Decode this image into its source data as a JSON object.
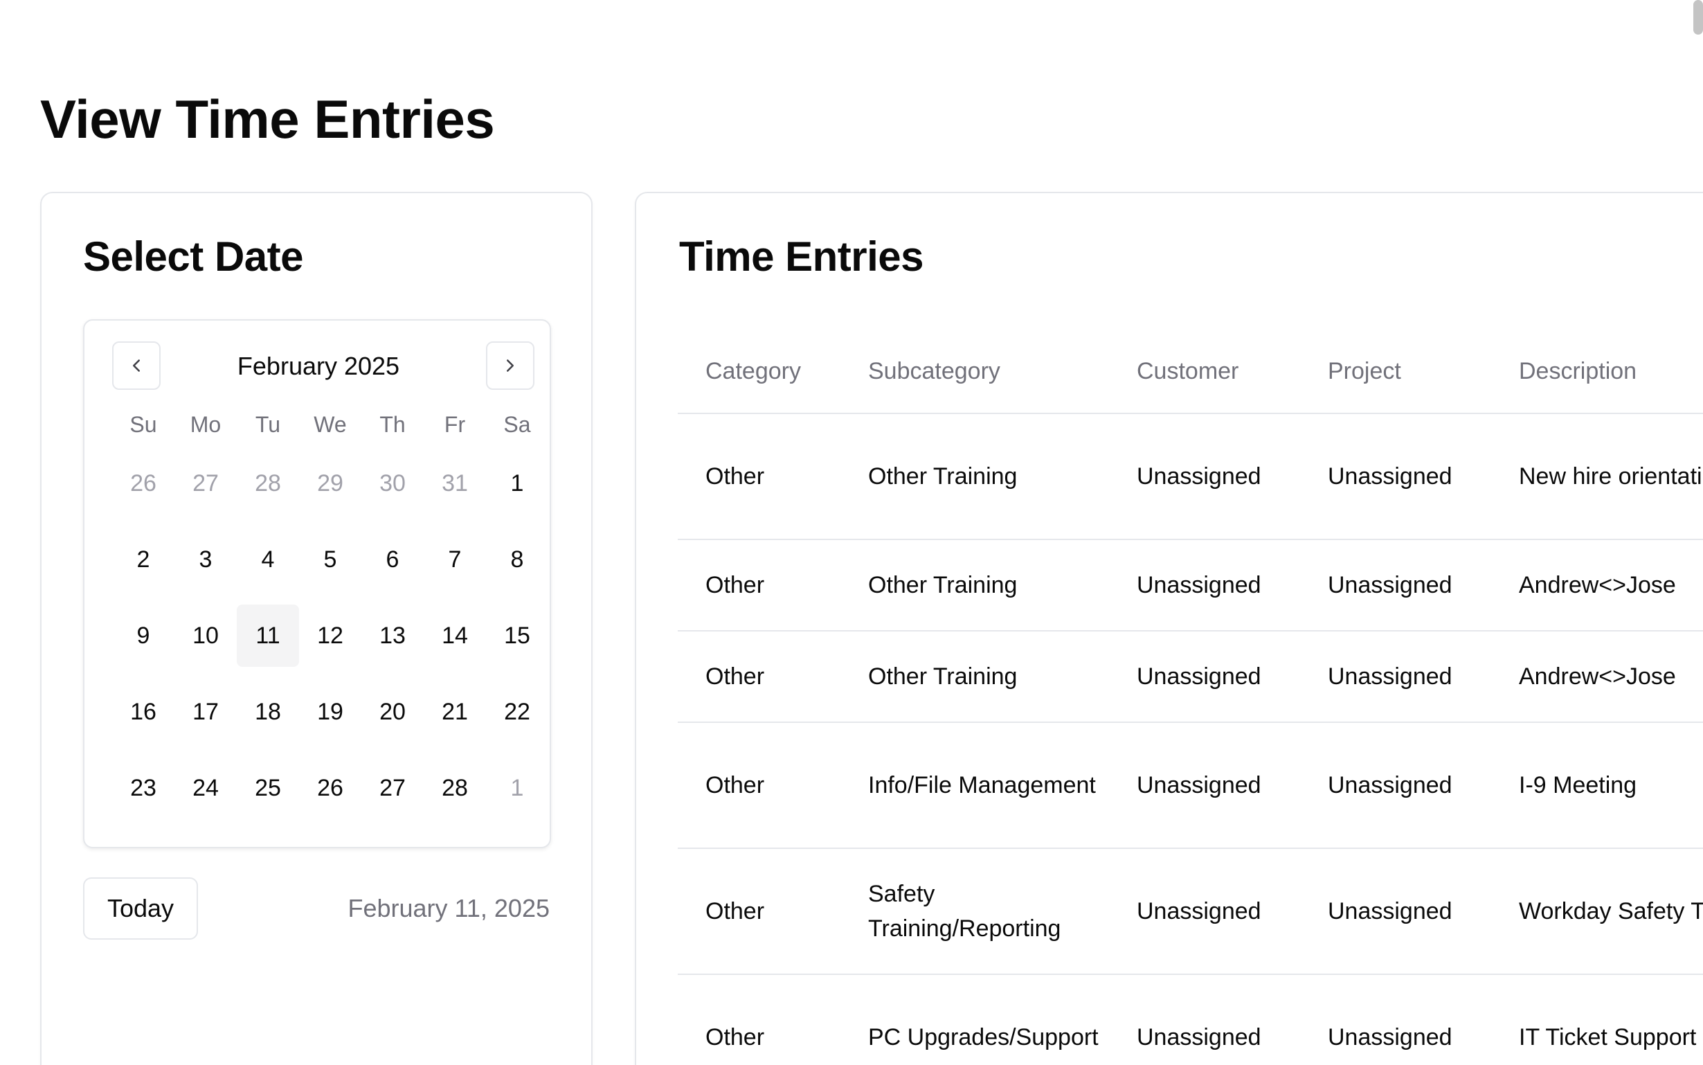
{
  "page": {
    "title": "View Time Entries"
  },
  "date_card": {
    "title": "Select Date",
    "calendar": {
      "month_label": "February 2025",
      "weekdays": [
        "Su",
        "Mo",
        "Tu",
        "We",
        "Th",
        "Fr",
        "Sa"
      ],
      "days": [
        {
          "label": "26",
          "outside": true
        },
        {
          "label": "27",
          "outside": true
        },
        {
          "label": "28",
          "outside": true
        },
        {
          "label": "29",
          "outside": true
        },
        {
          "label": "30",
          "outside": true
        },
        {
          "label": "31",
          "outside": true
        },
        {
          "label": "1"
        },
        {
          "label": "2"
        },
        {
          "label": "3"
        },
        {
          "label": "4"
        },
        {
          "label": "5"
        },
        {
          "label": "6"
        },
        {
          "label": "7"
        },
        {
          "label": "8"
        },
        {
          "label": "9"
        },
        {
          "label": "10"
        },
        {
          "label": "11",
          "selected": true
        },
        {
          "label": "12"
        },
        {
          "label": "13"
        },
        {
          "label": "14"
        },
        {
          "label": "15"
        },
        {
          "label": "16"
        },
        {
          "label": "17"
        },
        {
          "label": "18"
        },
        {
          "label": "19"
        },
        {
          "label": "20"
        },
        {
          "label": "21"
        },
        {
          "label": "22"
        },
        {
          "label": "23"
        },
        {
          "label": "24"
        },
        {
          "label": "25"
        },
        {
          "label": "26"
        },
        {
          "label": "27"
        },
        {
          "label": "28"
        },
        {
          "label": "1",
          "outside": true
        }
      ],
      "prev_icon": "chevron-left-icon",
      "next_icon": "chevron-right-icon"
    },
    "today_label": "Today",
    "selected_date_text": "February 11, 2025"
  },
  "entries_card": {
    "title": "Time Entries",
    "columns": [
      "Category",
      "Subcategory",
      "Customer",
      "Project",
      "Description"
    ],
    "rows": [
      {
        "cells": [
          "Other",
          "Other Training",
          "Unassigned",
          "Unassigned",
          "New hire orientation"
        ],
        "tall": true
      },
      {
        "cells": [
          "Other",
          "Other Training",
          "Unassigned",
          "Unassigned",
          "Andrew<>Jose"
        ],
        "tall": false
      },
      {
        "cells": [
          "Other",
          "Other Training",
          "Unassigned",
          "Unassigned",
          "Andrew<>Jose"
        ],
        "tall": false
      },
      {
        "cells": [
          "Other",
          "Info/File Management",
          "Unassigned",
          "Unassigned",
          "I-9 Meeting"
        ],
        "tall": true
      },
      {
        "cells": [
          "Other",
          "Safety Training/Reporting",
          "Unassigned",
          "Unassigned",
          "Workday Safety Training"
        ],
        "tall": true
      },
      {
        "cells": [
          "Other",
          "PC Upgrades/Support",
          "Unassigned",
          "Unassigned",
          "IT Ticket Support"
        ],
        "tall": true
      }
    ]
  },
  "colors": {
    "border": "#e5e7eb",
    "muted_text": "#71717a",
    "outside_day": "#a1a1aa",
    "selected_day_bg": "#f4f4f5"
  }
}
